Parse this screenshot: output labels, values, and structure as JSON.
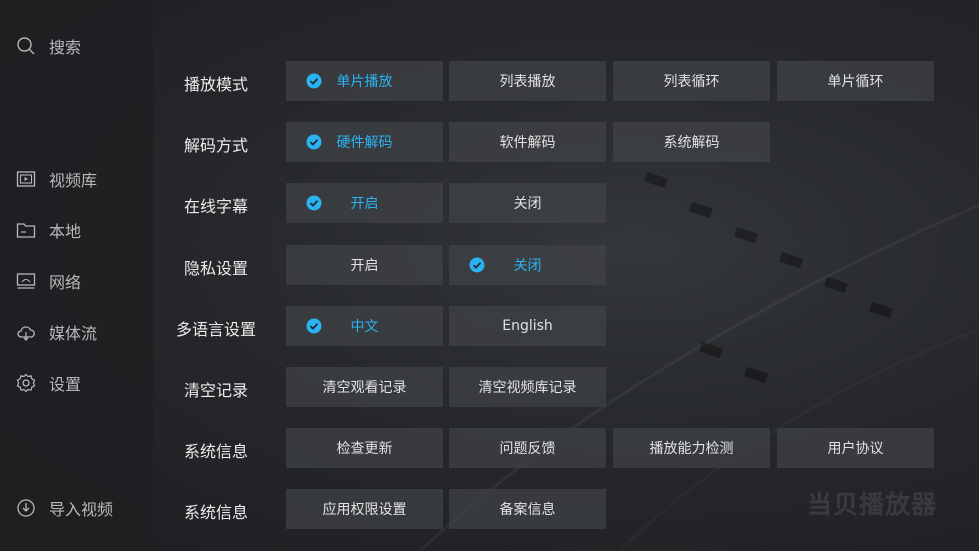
{
  "sidebar": {
    "search": "搜索",
    "items": [
      {
        "label": "视频库",
        "icon": "video-library-icon"
      },
      {
        "label": "本地",
        "icon": "folder-icon"
      },
      {
        "label": "网络",
        "icon": "network-icon"
      },
      {
        "label": "媒体流",
        "icon": "cloud-stream-icon"
      },
      {
        "label": "设置",
        "icon": "gear-icon"
      }
    ],
    "import": "导入视频"
  },
  "settings": [
    {
      "label": "播放模式",
      "options": [
        "单片播放",
        "列表播放",
        "列表循环",
        "单片循环"
      ],
      "selected": 0
    },
    {
      "label": "解码方式",
      "options": [
        "硬件解码",
        "软件解码",
        "系统解码"
      ],
      "selected": 0
    },
    {
      "label": "在线字幕",
      "options": [
        "开启",
        "关闭"
      ],
      "selected": 0
    },
    {
      "label": "隐私设置",
      "options": [
        "开启",
        "关闭"
      ],
      "selected": 1
    },
    {
      "label": "多语言设置",
      "options": [
        "中文",
        "English"
      ],
      "selected": 0
    },
    {
      "label": "清空记录",
      "options": [
        "清空观看记录",
        "清空视频库记录"
      ],
      "selected": null
    },
    {
      "label": "系统信息",
      "options": [
        "检查更新",
        "问题反馈",
        "播放能力检测",
        "用户协议"
      ],
      "selected": null
    },
    {
      "label": "系统信息",
      "options": [
        "应用权限设置",
        "备案信息"
      ],
      "selected": null
    }
  ],
  "watermark": "当贝播放器",
  "colors": {
    "accent": "#2ab3f0",
    "background": "#202124",
    "option_bg": "#404246"
  }
}
